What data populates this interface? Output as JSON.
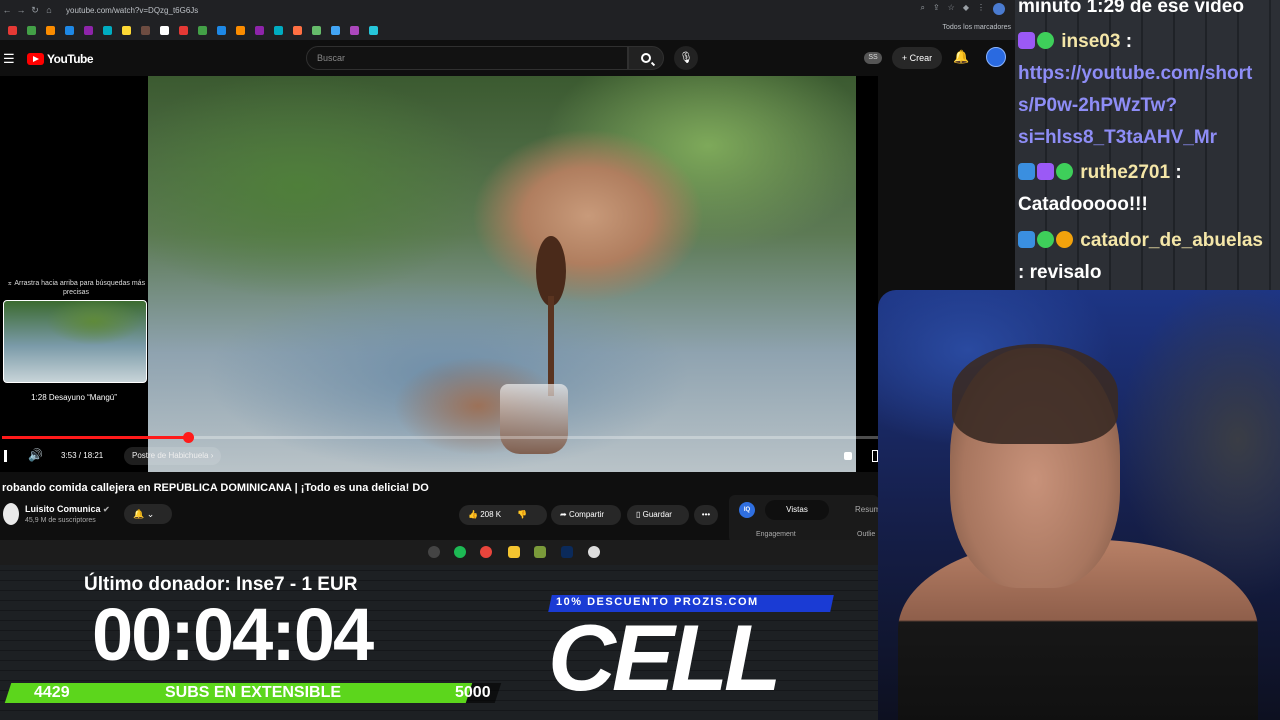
{
  "browser": {
    "url": "youtube.com/watch?v=DQzg_t6G6Js",
    "bookmarks_folder": "Todos los marcadores",
    "bookmark_colors": [
      "#e53935",
      "#43a047",
      "#fb8c00",
      "#1e88e5",
      "#8e24aa",
      "#00acc1",
      "#fdd835",
      "#6d4c41",
      "#ffffff",
      "#e53935",
      "#43a047",
      "#1e88e5",
      "#fb8c00",
      "#8e24aa",
      "#00acc1",
      "#ff7043",
      "#66bb6a",
      "#42a5f5",
      "#ab47bc",
      "#26c6da"
    ]
  },
  "youtube": {
    "logo_text": "YouTube",
    "search_placeholder": "Buscar",
    "ss_badge": "SS",
    "create_label": "+ Crear"
  },
  "player": {
    "scrub_hint": "⌅ Arrastra hacia arriba para búsquedas más precisas",
    "scrub_chapter": "1:28  Desayuno “Mangú”",
    "time": "3:53 / 18:21",
    "chapter_label": "Postre de Habichuela ›",
    "progress_fraction": 0.212
  },
  "video": {
    "title": "robando comida callejera en REPÚBLICA DOMINICANA | ¡Todo es una delicia! DO",
    "channel": "Luisito Comunica",
    "subscribers": "45,9 M de suscriptores",
    "likes": "208 K",
    "share_label": "Compartir",
    "save_label": "Guardar",
    "more_label": "•••"
  },
  "stats_panel": {
    "iq_label": "IQ",
    "tab_active": "Vistas",
    "tab_inactive": "Resum",
    "engagement": "Engagement",
    "outliers": "Outlie"
  },
  "overlay": {
    "donor": "Último donador: Inse7 - 1 EUR",
    "timer": "00:04:04",
    "subs_min": "4429",
    "subs_label": "SUBS EN EXTENSIBLE",
    "subs_max": "5000",
    "subs_fill_fraction": 0.94,
    "promo": "10% DESCUENTO PROZIS.COM",
    "brand": "CELL"
  },
  "chat": {
    "line1": "minuto 1:29 de ese video",
    "user1": "inse03",
    "link1a": "https://youtube.com/short",
    "link1b": "s/P0w-2hPWzTw?",
    "link1c": "si=hlss8_T3taAHV_Mr",
    "user2": "ruthe2701",
    "msg2": "Catadooooo!!!",
    "user3": "catador_de_abuelas",
    "msg3": ": revisalo"
  }
}
